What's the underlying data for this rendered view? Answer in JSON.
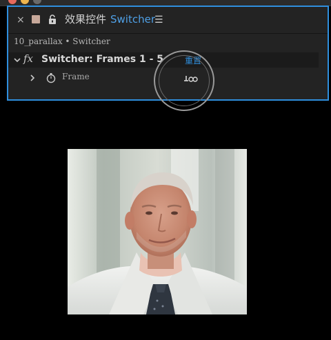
{
  "panel": {
    "title": "效果控件",
    "layer_name": "Switcher",
    "menu_icon": "hamburger-menu-icon",
    "breadcrumb": "10_parallax • Switcher"
  },
  "effect": {
    "name": "Switcher: Frames 1 - 5",
    "reset_label": "重置",
    "property": {
      "name": "Frame"
    }
  },
  "colors": {
    "accent": "#2f8fde",
    "panel_bg": "#232323",
    "background": "#000000"
  },
  "preview": {
    "subject": "man in white shirt and dark patterned tie"
  }
}
